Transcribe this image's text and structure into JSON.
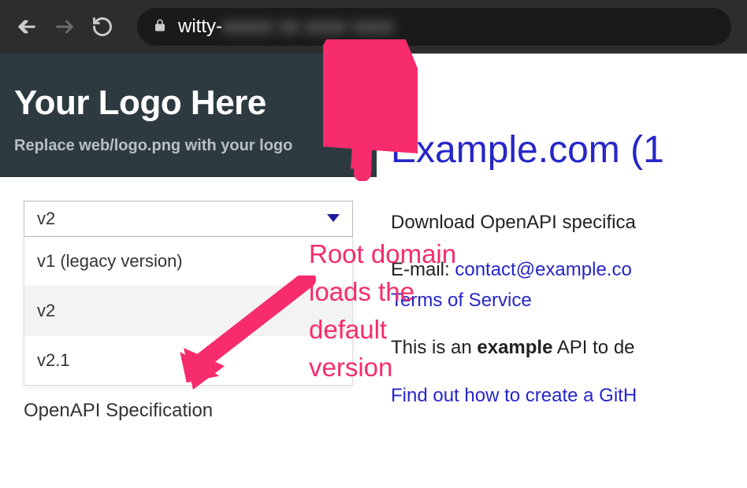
{
  "browser": {
    "url_visible": "witty-",
    "url_blurred": "xxxxx xx xxxx xxxx"
  },
  "sidebar": {
    "logo_title": "Your  Logo Here",
    "logo_subtitle": "Replace web/logo.png with your logo",
    "version_selected": "v2",
    "versions": [
      "v1 (legacy version)",
      "v2",
      "v2.1"
    ],
    "spec_label": "OpenAPI Specification"
  },
  "main": {
    "title": "Example.com (1",
    "download_text": "Download OpenAPI specifica",
    "email_label": "E-mail: ",
    "email_value": "contact@example.co",
    "terms_link": "Terms of Service",
    "description_prefix": "This is an ",
    "description_bold": "example",
    "description_suffix": " API to de",
    "find_out_link": "Find out how to create a GitH"
  },
  "annotation": {
    "text": "Root domain loads the default version"
  }
}
